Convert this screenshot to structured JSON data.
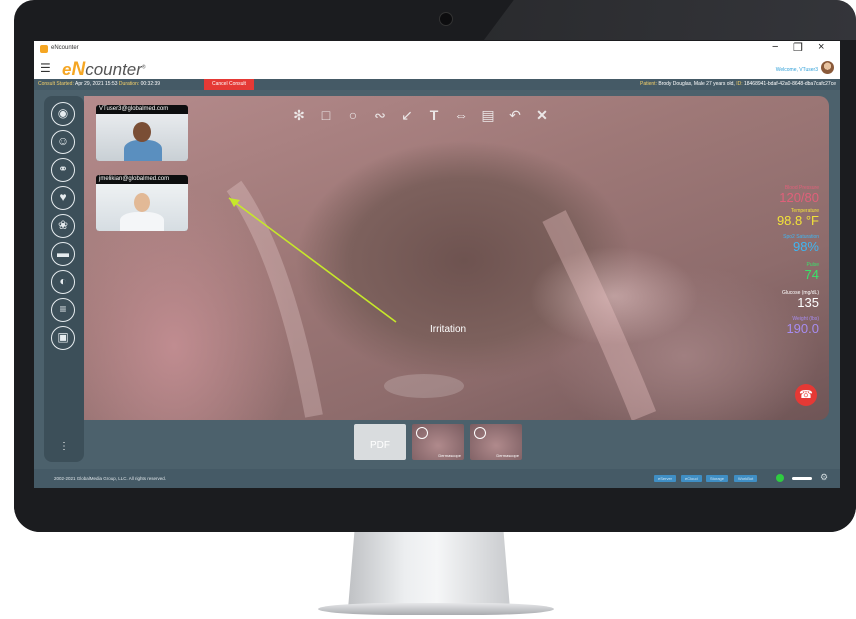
{
  "window": {
    "app_name": "eNcounter",
    "minimize": "−",
    "restore": "❐",
    "close": "×"
  },
  "header": {
    "brand_e": "e",
    "brand_n": "N",
    "brand_rest": "counter",
    "trademark": "®",
    "welcome": "Welcome, VTuser3"
  },
  "infobar": {
    "started_label": "Consult Started:",
    "started_value": "Apr 29, 2021 15:53",
    "duration_label": "Duration:",
    "duration_value": "00:32:39",
    "cancel": "Cancel Consult",
    "patient_label": "Patient:",
    "patient_value": "Brody Douglas, Male 27 years old,",
    "id_label": "ID:",
    "id_value": "18468941-bdaf-42a0-8648-dba7cafc27ce"
  },
  "left_rail": {
    "tools": [
      "otoscope-icon",
      "person-icon",
      "stethoscope-icon",
      "heart-monitor-icon",
      "lungs-icon",
      "dermascope-icon",
      "ear-icon",
      "thermometer-icon",
      "document-icon"
    ],
    "more": "⋮"
  },
  "annotation_tools": [
    "aperture-icon",
    "square-icon",
    "circle-icon",
    "freehand-icon",
    "arrow-icon",
    "text-icon",
    "measure-icon",
    "ruler-icon",
    "undo-icon",
    "close-icon"
  ],
  "participants": [
    {
      "email": "VTuser3@globalmed.com"
    },
    {
      "email": "jmelikian@globalmed.com"
    }
  ],
  "annotation": {
    "label": "Irritation",
    "arrow_color": "#c6e82a"
  },
  "vitals": [
    {
      "label": "Blood Pressure",
      "value": "120/80",
      "color": "#e0607a"
    },
    {
      "label": "Temperature",
      "value": "98.8 °F",
      "color": "#f2e23a"
    },
    {
      "label": "Spo2 Saturation",
      "value": "98%",
      "color": "#3fb6f2"
    },
    {
      "label": "Pulse",
      "value": "74",
      "color": "#39e36a"
    },
    {
      "label": "Glucose (mg/dL)",
      "value": "135",
      "color": "#ffffff"
    },
    {
      "label": "Weight (lbs)",
      "value": "190.0",
      "color": "#a78cf0"
    }
  ],
  "thumbnails": [
    {
      "type": "pdf",
      "label": "PDF"
    },
    {
      "type": "image",
      "tag": "Dermascope"
    },
    {
      "type": "image",
      "tag": "Dermascope"
    }
  ],
  "footer": {
    "copyright": "2002-2021 GlobalMedia Group, LLC. All rights reserved.",
    "buttons": [
      "eServer",
      "eCloud",
      "Storage",
      "WorkBot"
    ]
  },
  "colors": {
    "accent": "#f5a623",
    "bar": "#455a66",
    "cancel": "#e53935"
  }
}
